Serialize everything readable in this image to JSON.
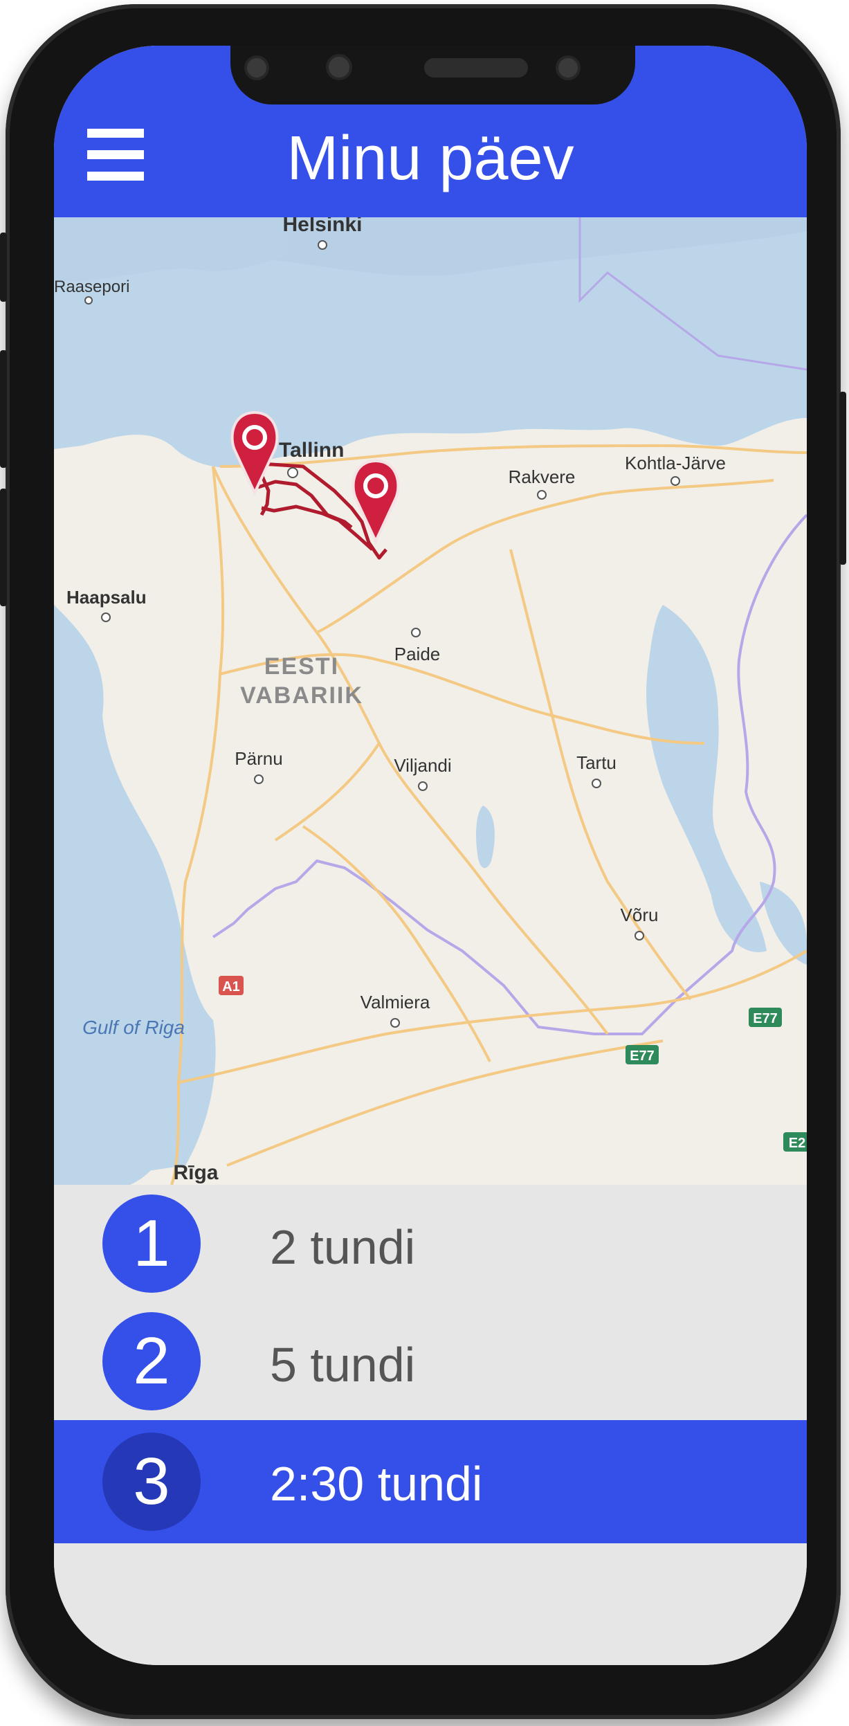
{
  "header": {
    "title": "Minu päev",
    "menu_icon": "hamburger-menu-icon",
    "background": "#3550e8"
  },
  "map": {
    "water_labels": [
      "Gulf of Riga"
    ],
    "country_labels": [
      "EESTI",
      "VABARIIK"
    ],
    "cities": [
      "Helsinki",
      "Raasepori",
      "Tallinn",
      "Rakvere",
      "Kohtla-Järve",
      "Haapsalu",
      "Paide",
      "Pärnu",
      "Viljandi",
      "Tartu",
      "Võru",
      "Valmiera",
      "Rīga"
    ],
    "route_shields": [
      "A1",
      "E77",
      "E77",
      "E2"
    ],
    "markers": [
      "map-pin-icon",
      "map-pin-icon"
    ],
    "route_color": "#b01c2e",
    "marker_color": "#d0203f"
  },
  "days": [
    {
      "number": "1",
      "label": "2 tundi",
      "selected": false
    },
    {
      "number": "2",
      "label": "5 tundi",
      "selected": false
    },
    {
      "number": "3",
      "label": "2:30 tundi",
      "selected": true
    }
  ]
}
